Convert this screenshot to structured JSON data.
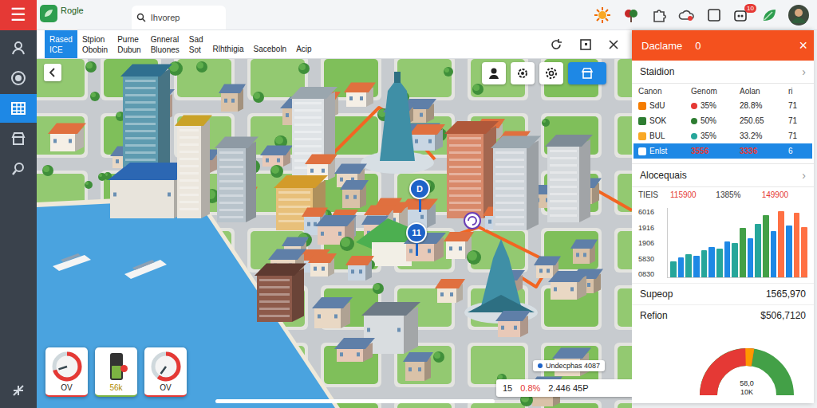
{
  "app": {
    "menu_icon": "☰",
    "logo": "Rogle"
  },
  "search": {
    "placeholder": "Ihvorep"
  },
  "top_bar": {
    "badge": "10"
  },
  "sidebar": {
    "items": [
      {
        "selected": false
      },
      {
        "selected": false
      },
      {
        "selected": true
      },
      {
        "selected": false
      },
      {
        "selected": false
      }
    ]
  },
  "toolbar": {
    "tabs": [
      {
        "lines": [
          "Rased",
          "ICE"
        ],
        "selected": true
      },
      {
        "lines": [
          "Stpion",
          "Obobin"
        ],
        "selected": false
      },
      {
        "lines": [
          "Purne",
          "Dubun"
        ],
        "selected": false
      },
      {
        "lines": [
          "Gnneral",
          "Bluones"
        ],
        "selected": false
      },
      {
        "lines": [
          "Sad",
          "Sot"
        ],
        "selected": false
      },
      {
        "lines": [
          "Rlhthigia"
        ],
        "selected": false
      },
      {
        "lines": [
          "Saceboln"
        ],
        "selected": false
      },
      {
        "lines": [
          "Acip"
        ],
        "selected": false
      }
    ]
  },
  "map": {
    "tools": [
      {
        "selected": false
      },
      {
        "selected": false
      },
      {
        "selected": false
      },
      {
        "selected": true
      }
    ],
    "pins": [
      {
        "label": "D"
      },
      {
        "label": "11"
      }
    ],
    "gauges": [
      {
        "kind": "dial",
        "label": "OV",
        "level": 0.7,
        "color": "#e53935"
      },
      {
        "kind": "battery",
        "label": "56k",
        "level": 0.55,
        "color": "#7cb342"
      },
      {
        "kind": "dial",
        "label": "OV",
        "level": 0.6,
        "color": "#e53935"
      }
    ],
    "tooltip": "Undecphas 4087",
    "stats": [
      {
        "text": "15",
        "color": "#222222"
      },
      {
        "text": "0.8%",
        "color": "#e53935"
      },
      {
        "text": "2.446 45P",
        "color": "#222222"
      }
    ]
  },
  "panel": {
    "title": "Daclame",
    "count": "0",
    "close": "×",
    "station": {
      "title": "Staidion",
      "chevron": "›",
      "columns": [
        "Canon",
        "Genom",
        "Aolan",
        "ri"
      ],
      "rows": [
        {
          "cells": [
            "SdU",
            "35%",
            "28.8%",
            "71"
          ],
          "icon_color": "#f57c00",
          "color": "#e53935",
          "selected": false
        },
        {
          "cells": [
            "SOK",
            "50%",
            "250.65",
            "71"
          ],
          "icon_color": "#2e7d32",
          "color": "#2e7d32",
          "selected": false
        },
        {
          "cells": [
            "BUL",
            "35%",
            "33.2%",
            "71"
          ],
          "icon_color": "#f9a825",
          "color": "#26a69a",
          "selected": false
        },
        {
          "cells": [
            "Enlst",
            "3556",
            "3336",
            "6"
          ],
          "icon_color": "#ffffff",
          "color": "#e53935",
          "selected": true
        }
      ]
    },
    "allocations": {
      "title": "Alocequais",
      "chevron": "›",
      "summary": [
        {
          "text": "TIEIS",
          "color": "#333333"
        },
        {
          "text": "115900",
          "color": "#e53935"
        },
        {
          "text": "1385%",
          "color": "#333333"
        },
        {
          "text": "149900",
          "color": "#e53935"
        }
      ],
      "ticks": [
        "6016",
        "1916",
        "1906",
        "5830",
        "0830"
      ],
      "values": [
        18,
        22,
        26,
        24,
        30,
        34,
        32,
        40,
        38,
        55,
        44,
        60,
        70,
        52,
        74,
        58,
        72,
        56
      ],
      "colors": [
        "#26a69a",
        "#1e88e5",
        "#26a69a",
        "#1e88e5",
        "#26a69a",
        "#1e88e5",
        "#26a69a",
        "#1e88e5",
        "#26a69a",
        "#43a047",
        "#1e88e5",
        "#26a69a",
        "#43a047",
        "#1e88e5",
        "#ff7043",
        "#1e88e5",
        "#ff7043",
        "#ff7043"
      ]
    },
    "totals": [
      {
        "label": "Supeop",
        "value": "1565,970"
      },
      {
        "label": "Refion",
        "value": "$506,7120"
      }
    ],
    "gauge": {
      "level": 0.55,
      "readings": [
        "58,0",
        "10K"
      ]
    }
  }
}
